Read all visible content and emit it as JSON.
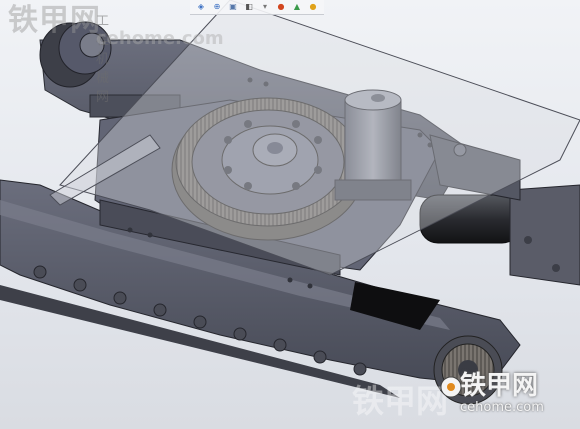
{
  "watermark_top_left": {
    "brand_cn": "铁甲网",
    "sub": "工程机械网",
    "url": "cehome.com"
  },
  "watermark_bottom_right": {
    "brand_cn": "铁甲网",
    "url": "cehome.com",
    "faint": "铁甲网"
  },
  "toolbar": {
    "icons": [
      "view-orientation-icon",
      "zoom-icon",
      "section-view-icon",
      "display-style-icon",
      "hide-show-icon",
      "edit-appearance-icon",
      "scene-icon",
      "render-icon"
    ]
  },
  "colors": {
    "steel": "#5c5f6e",
    "steel_dark": "#3a3c46",
    "glass": "#c6cad2",
    "gear": "#6e6a66",
    "background": "#e6e9ee"
  }
}
